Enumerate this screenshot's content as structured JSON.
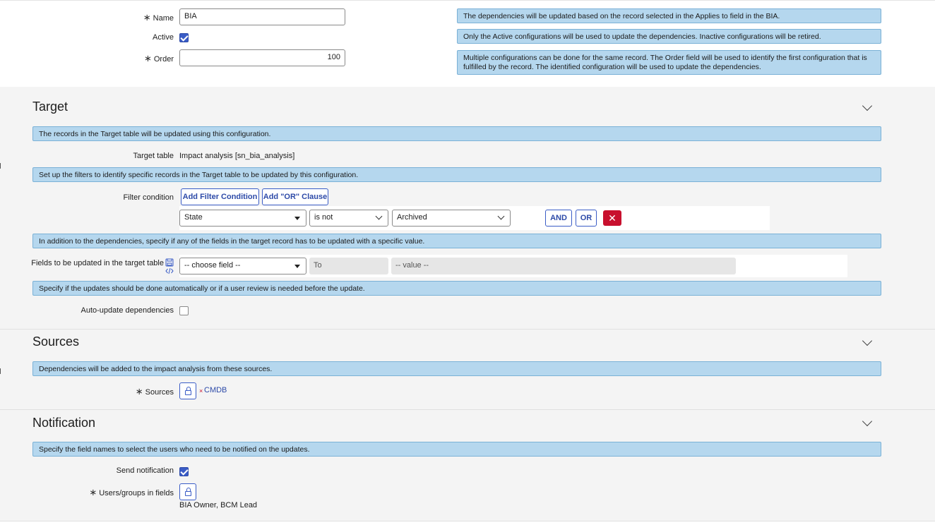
{
  "form": {
    "name_label": "Name",
    "name_value": "BIA",
    "active_label": "Active",
    "active_checked": true,
    "order_label": "Order",
    "order_value": "100",
    "required_marker": "∗"
  },
  "info_top": {
    "applies": "The dependencies will be updated based on the record selected in the Applies to field in the BIA.",
    "active": "Only the Active configurations will be used to update the dependencies. Inactive configurations will be retired.",
    "order": "Multiple configurations can be done for the same record. The Order field will be used to identify the first configuration that is fulfilled by the record. The identified configuration will be used to update the dependencies."
  },
  "target": {
    "title": "Target",
    "info_records": "The records in the Target table will be updated using this configuration.",
    "target_table_label": "Target table",
    "target_table_value": "Impact analysis [sn_bia_analysis]",
    "info_filters": "Set up the filters to identify specific records in the Target table to be updated by this configuration.",
    "filter_condition_label": "Filter condition",
    "add_filter_label": "Add Filter Condition",
    "add_or_label": "Add \"OR\" Clause",
    "filter_field": "State",
    "filter_operator": "is not",
    "filter_value": "Archived",
    "and_label": "AND",
    "or_label": "OR",
    "delete_symbol": "✕",
    "info_fields": "In addition to the dependencies, specify if any of the fields in the target record has to be updated with a specific value.",
    "fields_label": "Fields to be updated in the target table",
    "choose_field": "-- choose field --",
    "to_label": "To",
    "value_placeholder": "-- value --",
    "info_auto": "Specify if the updates should be done automatically or if a user review is needed before the update.",
    "auto_update_label": "Auto-update dependencies",
    "auto_update_checked": false
  },
  "sources": {
    "title": "Sources",
    "info": "Dependencies will be added to the impact analysis from these sources.",
    "sources_label": "Sources",
    "remove_symbol": "×",
    "source_item": "CMDB"
  },
  "notification": {
    "title": "Notification",
    "info": "Specify the field names to select the users who need to be notified on the updates.",
    "send_label": "Send notification",
    "send_checked": true,
    "users_label": "Users/groups in fields",
    "users_value": "BIA Owner, BCM Lead"
  },
  "colors": {
    "accent": "#3a5cc6",
    "info_bg": "#b5d7ee",
    "info_border": "#7ab1d6",
    "danger": "#c8102e",
    "section_bg": "#f4f4f4"
  },
  "icons": [
    "lock-icon",
    "chevron-down-icon",
    "caret-down-icon",
    "close-icon",
    "save-template-icon",
    "code-icon",
    "checkmark-icon"
  ]
}
